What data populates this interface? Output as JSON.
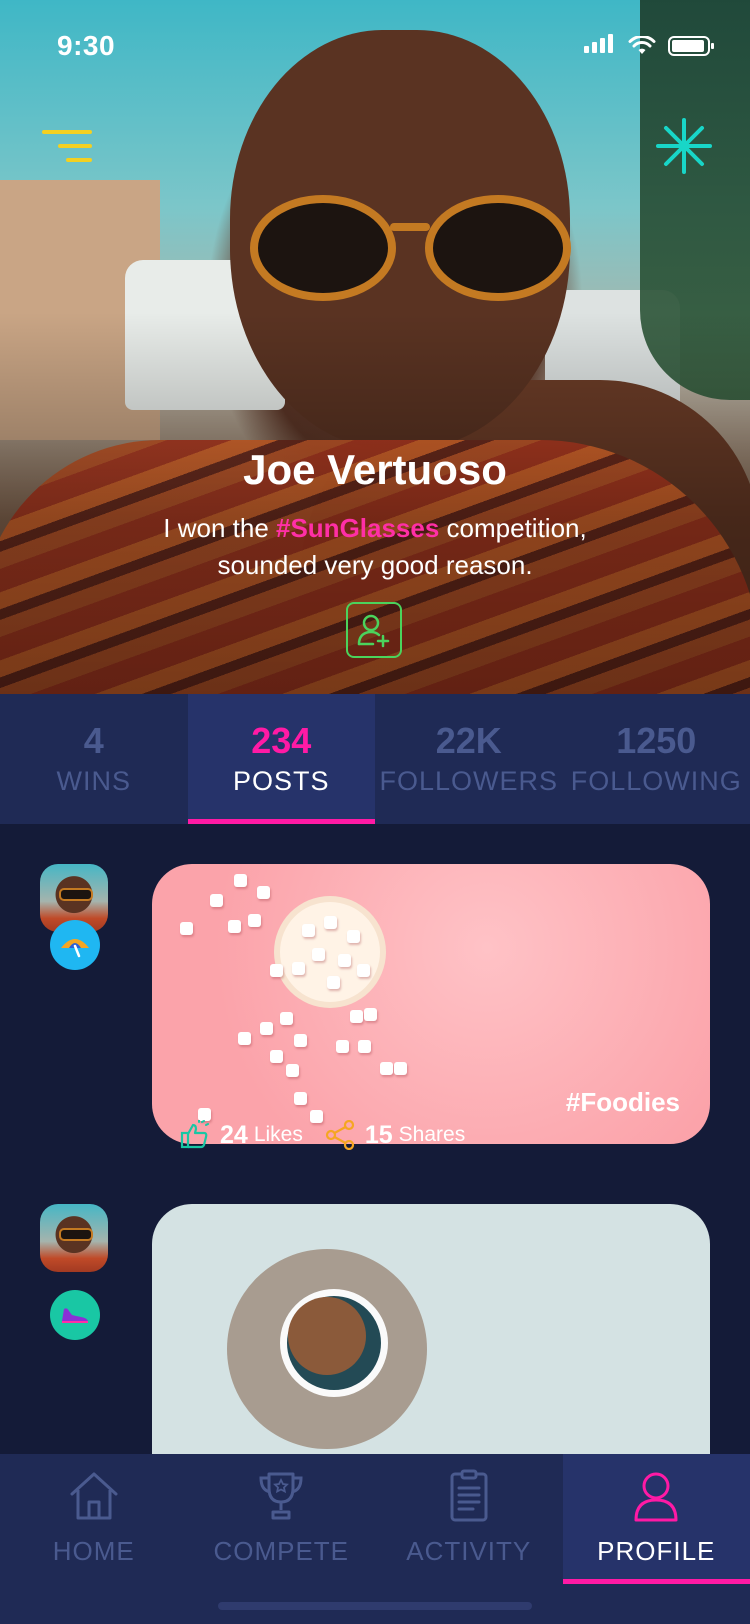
{
  "status_bar": {
    "time": "9:30"
  },
  "profile": {
    "name": "Joe Vertuoso",
    "bio_before": "I won the ",
    "bio_tag": "#SunGlasses",
    "bio_after": " competition, sounded very good reason."
  },
  "stats": [
    {
      "value": "4",
      "label": "WINS",
      "active": false
    },
    {
      "value": "234",
      "label": "POSTS",
      "active": true
    },
    {
      "value": "22K",
      "label": "FOLLOWERS",
      "active": false
    },
    {
      "value": "1250",
      "label": "FOLLOWING",
      "active": false
    }
  ],
  "posts": [
    {
      "tag": "#Foodies",
      "likes": "24",
      "likes_label": "Likes",
      "shares": "15",
      "shares_label": "Shares",
      "category_icon": "beach-umbrella-icon",
      "category_color": "#1fb7f2"
    },
    {
      "category_icon": "sneaker-icon",
      "category_color": "#19c7a4"
    }
  ],
  "tabs": [
    {
      "label": "HOME",
      "icon": "home-icon"
    },
    {
      "label": "COMPETE",
      "icon": "trophy-icon"
    },
    {
      "label": "ACTIVITY",
      "icon": "clipboard-icon"
    },
    {
      "label": "PROFILE",
      "icon": "user-icon"
    }
  ],
  "colors": {
    "accent": "#ff1aa5",
    "menu": "#f3d021",
    "star": "#18d6c8",
    "add": "#4bd35c",
    "panel": "#1f2a55",
    "background": "#141b38"
  }
}
